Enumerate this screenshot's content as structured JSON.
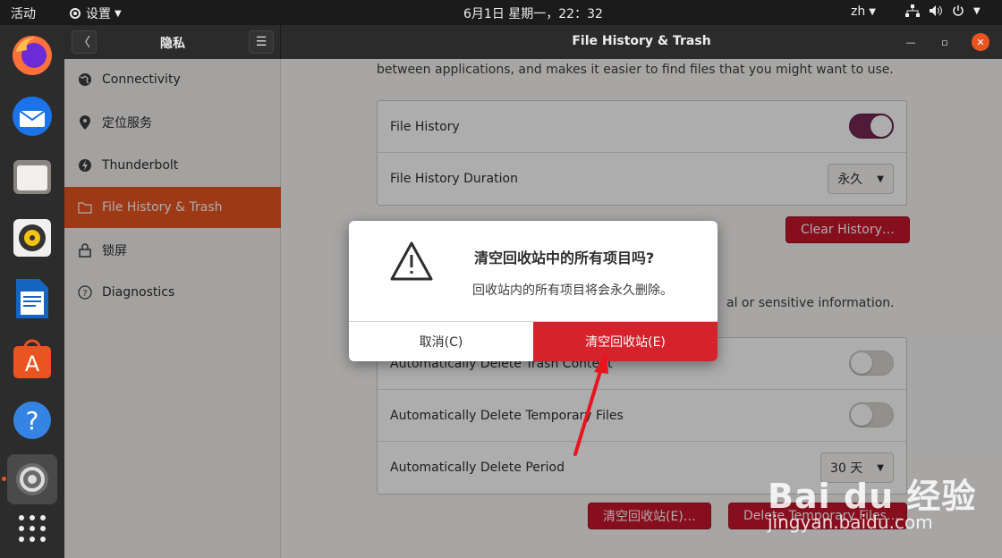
{
  "topbar": {
    "activities": "活动",
    "app_menu": "设置",
    "clock": "6月1日 星期一，22：32",
    "lang": "zh"
  },
  "window": {
    "sidebar_title": "隐私",
    "title": "File History & Trash"
  },
  "sidebar": {
    "items": [
      {
        "label": "Connectivity",
        "icon": "globe-icon"
      },
      {
        "label": "定位服务",
        "icon": "location-icon"
      },
      {
        "label": "Thunderbolt",
        "icon": "thunderbolt-icon"
      },
      {
        "label": "File History & Trash",
        "icon": "folder-icon"
      },
      {
        "label": "锁屏",
        "icon": "lock-icon"
      },
      {
        "label": "Diagnostics",
        "icon": "help-icon"
      }
    ]
  },
  "content": {
    "description": "between applications, and makes it easier to find files that you might want to use.",
    "description2": "al or sensitive information.",
    "file_history_label": "File History",
    "file_history_on": true,
    "duration_label": "File History Duration",
    "duration_value": "永久",
    "clear_history_button": "Clear History…",
    "trash_rows": [
      {
        "label": "Automatically Delete Trash Content",
        "on": false
      },
      {
        "label": "Automatically Delete Temporary Files",
        "on": false
      }
    ],
    "period_label": "Automatically Delete Period",
    "period_value": "30 天",
    "empty_trash_button": "清空回收站(E)…",
    "delete_temp_button": "Delete Temporary Files…"
  },
  "dialog": {
    "title": "清空回收站中的所有项目吗?",
    "message": "回收站内的所有项目将会永久删除。",
    "cancel": "取消(C)",
    "confirm": "清空回收站(E)"
  },
  "watermark": {
    "brand": "Bai du 经验",
    "url": "jingyan.baidu.com"
  },
  "colors": {
    "accent": "#e95420",
    "danger": "#c7162b",
    "toggle_on": "#772953"
  }
}
